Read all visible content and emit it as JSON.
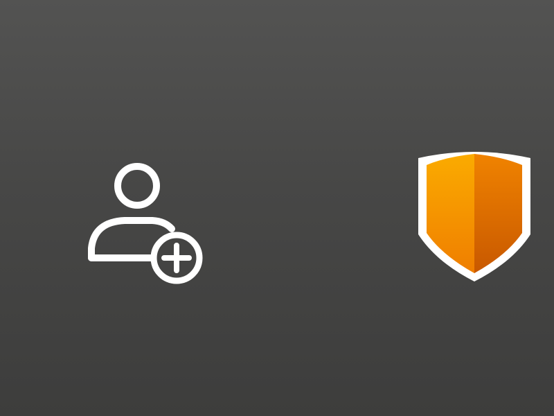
{
  "window": {
    "title": ""
  },
  "toolbar": {
    "buttons": [
      {
        "id": "add-user",
        "icon": "add-user-icon",
        "color": "#ffffff"
      },
      {
        "id": "security",
        "icon": "shield-icon",
        "colors": {
          "light": "#f8a300",
          "dark": "#d86a00",
          "border": "#ffffff"
        }
      }
    ]
  },
  "colors": {
    "background_top": "#535352",
    "background_bottom": "#3d3d3c"
  }
}
